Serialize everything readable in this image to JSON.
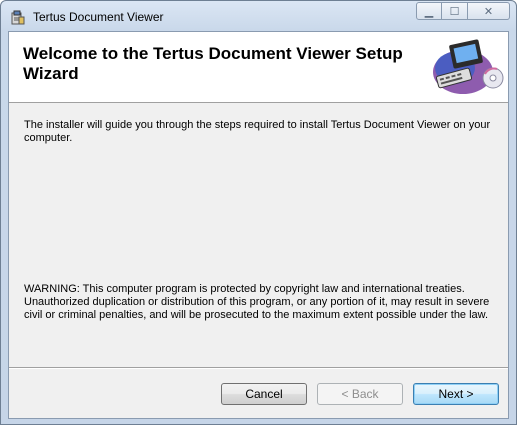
{
  "window": {
    "title": "Tertus Document Viewer",
    "minimize_glyph": "▁",
    "maximize_glyph": "☐",
    "close_glyph": "✕",
    "icon": "installer-app-icon"
  },
  "banner": {
    "heading": "Welcome to the Tertus Document Viewer Setup Wizard",
    "art_icon": "computer-with-cd-icon"
  },
  "body": {
    "intro": "The installer will guide you through the steps required to install Tertus Document Viewer on your computer.",
    "warning": "WARNING: This computer program is protected by copyright law and international treaties. Unauthorized duplication or distribution of this program, or any portion of it, may result in severe civil or criminal penalties, and will be prosecuted to the maximum extent possible under the law."
  },
  "buttons": {
    "cancel": "Cancel",
    "back": "< Back",
    "next": "Next >"
  },
  "colors": {
    "frame": "#c6d5e8",
    "client_bg": "#f0f0f0",
    "default_button_border": "#3c7fb1"
  }
}
